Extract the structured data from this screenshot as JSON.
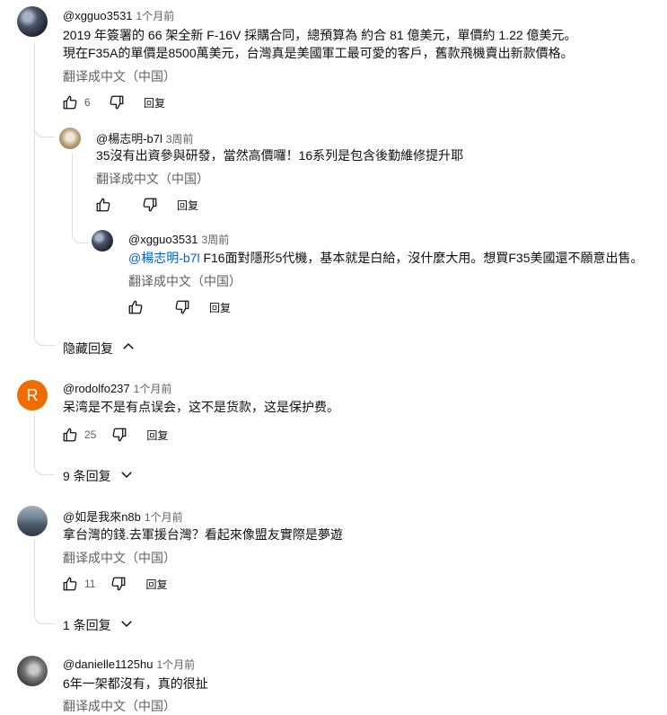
{
  "comments": [
    {
      "handle": "@xgguo3531",
      "time": "1个月前",
      "lines": [
        "2019 年簽署的 66 架全新 F-16V 採購合同，總預算為 約合 81 億美元，單價約 1.22 億美元。",
        "現在F35A的單價是8500萬美元，台灣真是美國軍工最可愛的客戶，舊款飛機賣出新款價格。"
      ],
      "translate": "翻译成中文（中国）",
      "likes": "6",
      "reply_label": "回复"
    },
    {
      "handle": "@楊志明-b7l",
      "time": "3周前",
      "lines": [
        "35沒有出資參與研發，當然高價囉！16系列是包含後勤維修提升耶"
      ],
      "translate": "翻译成中文（中国）",
      "likes": "",
      "reply_label": "回复"
    },
    {
      "handle": "@xgguo3531",
      "time": "3周前",
      "mention": "@楊志明-b7l",
      "line_after_mention": " F16面對隱形5代機，基本就是白給，沒什麼大用。想買F35美國還不願意出售。",
      "translate": "翻译成中文（中国）",
      "likes": "",
      "reply_label": "回复"
    },
    {
      "handle": "@rodolfo237",
      "time": "1个月前",
      "avatar_letter": "R",
      "lines": [
        "呆湾是不是有点误会，这不是货款，这是保护费。"
      ],
      "likes": "25",
      "reply_label": "回复"
    },
    {
      "handle": "@如是我來n8b",
      "time": "1个月前",
      "lines": [
        "拿台灣的錢.去軍援台灣？看起來像盟友實際是夢遊"
      ],
      "translate": "翻译成中文（中国）",
      "likes": "11",
      "reply_label": "回复"
    },
    {
      "handle": "@danielle1125hu",
      "time": "1个月前",
      "lines": [
        "6年一架都沒有，真的很扯"
      ],
      "translate": "翻译成中文（中国）"
    }
  ],
  "toggles": {
    "hide_replies": "隐藏回复",
    "rodolfo_replies": "9 条回复",
    "rushi_replies": "1 条回复"
  },
  "icons": {
    "like": "thumb-up-icon",
    "dislike": "thumb-down-icon",
    "chevron_up": "chevron-up-icon",
    "chevron_down": "chevron-down-icon"
  },
  "colors": {
    "link": "#065fd4",
    "avatar_r": "#ef6c00",
    "secondary_text": "#606060"
  }
}
